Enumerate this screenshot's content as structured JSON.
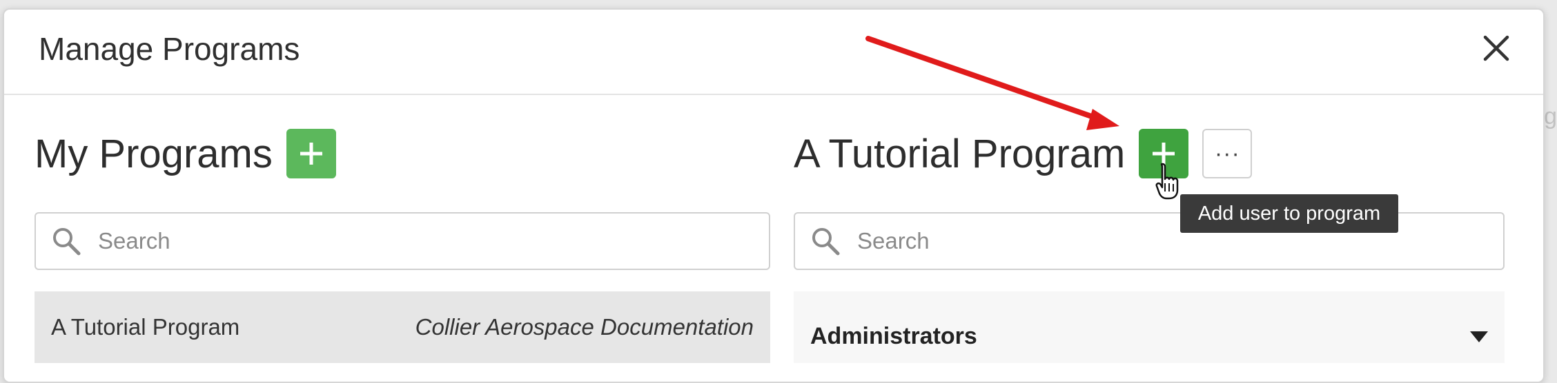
{
  "modal": {
    "title": "Manage Programs"
  },
  "left": {
    "heading": "My Programs",
    "search_placeholder": "Search",
    "programs": [
      {
        "name": "A Tutorial Program",
        "org": "Collier Aerospace Documentation"
      }
    ]
  },
  "right": {
    "heading": "A Tutorial Program",
    "search_placeholder": "Search",
    "more_label": "···",
    "tooltip": "Add user to program",
    "groups": [
      {
        "label": "Administrators"
      }
    ]
  },
  "background": {
    "partial_text": "g"
  },
  "colors": {
    "add_button": "#5cb85c",
    "add_button_active": "#3fa33f",
    "annotation_arrow": "#e01b1b",
    "tooltip_bg": "#3a3a3a"
  },
  "icons": [
    "close-icon",
    "plus-icon",
    "search-icon",
    "caret-down-icon",
    "hand-cursor-icon"
  ]
}
